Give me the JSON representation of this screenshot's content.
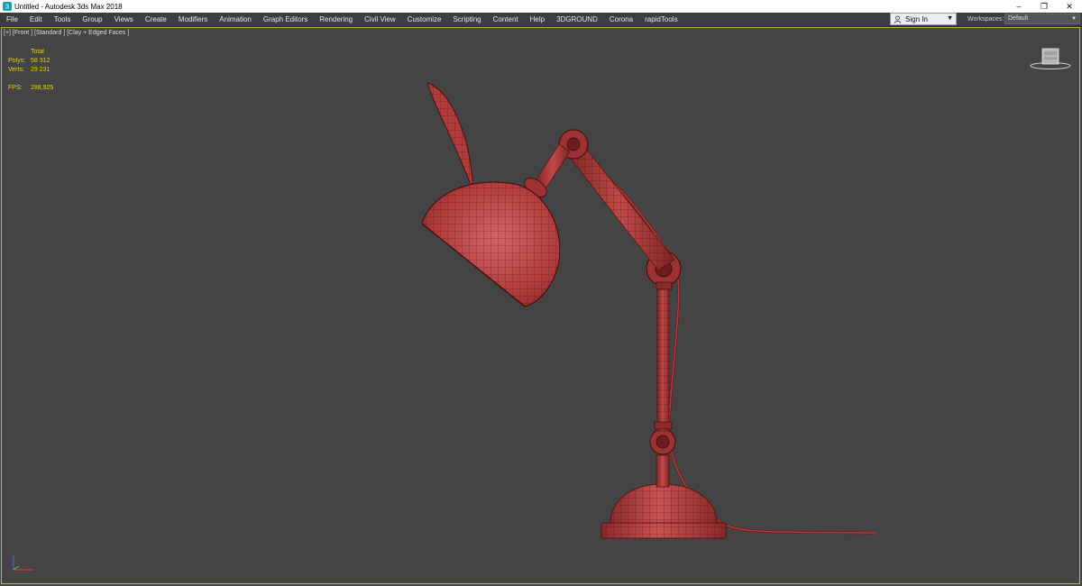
{
  "window": {
    "title": "Untitled - Autodesk 3ds Max 2018",
    "minimize_glyph": "–",
    "restore_glyph": "❐",
    "close_glyph": "✕"
  },
  "menu": {
    "items": [
      "File",
      "Edit",
      "Tools",
      "Group",
      "Views",
      "Create",
      "Modifiers",
      "Animation",
      "Graph Editors",
      "Rendering",
      "Civil View",
      "Customize",
      "Scripting",
      "Content",
      "Help",
      "3DGROUND",
      "Corona",
      "rapidTools"
    ]
  },
  "signin": {
    "label": "Sign In",
    "arrow": "▼"
  },
  "workspaces": {
    "label": "Workspaces:",
    "value": "Default",
    "arrow": "▼"
  },
  "viewport": {
    "label": "[+] [Front ] [Standard ] [Clay + Edged Faces ]",
    "border_color": "#c8b23a",
    "background": "#444444"
  },
  "stats": {
    "header": "Total",
    "polys_label": "Polys:",
    "polys_value": "58 312",
    "verts_label": "Verts:",
    "verts_value": "29 231",
    "fps_label": "FPS:",
    "fps_value": "288,925",
    "color": "#e2cf2a"
  },
  "model": {
    "color": "#b8403f",
    "wire_color": "#5a1414"
  }
}
